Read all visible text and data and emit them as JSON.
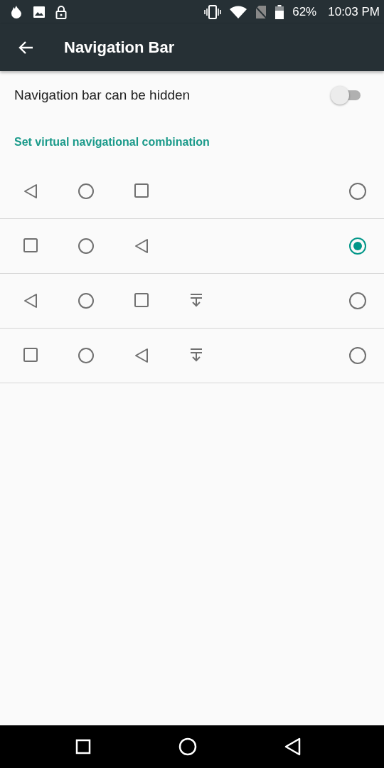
{
  "status_bar": {
    "battery": "62%",
    "time": "10:03 PM"
  },
  "toolbar": {
    "title": "Navigation Bar"
  },
  "toggle": {
    "label": "Navigation bar can be hidden",
    "on": false
  },
  "section_header": "Set virtual navigational combination",
  "combinations": [
    {
      "buttons": [
        {
          "kind": "back"
        },
        {
          "kind": "home"
        },
        {
          "kind": "recent"
        }
      ],
      "selected": false
    },
    {
      "buttons": [
        {
          "kind": "recent"
        },
        {
          "kind": "home"
        },
        {
          "kind": "back"
        }
      ],
      "selected": true
    },
    {
      "buttons": [
        {
          "kind": "back"
        },
        {
          "kind": "home"
        },
        {
          "kind": "recent"
        },
        {
          "kind": "hide"
        }
      ],
      "selected": false
    },
    {
      "buttons": [
        {
          "kind": "recent"
        },
        {
          "kind": "home"
        },
        {
          "kind": "back"
        },
        {
          "kind": "hide"
        }
      ],
      "selected": false
    }
  ]
}
